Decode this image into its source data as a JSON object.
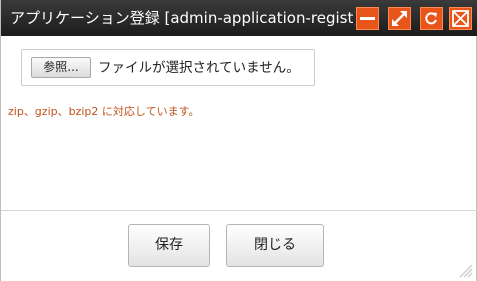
{
  "window": {
    "title": "アプリケーション登録 [admin-application-regist]"
  },
  "titlebar_buttons": {
    "minimize": "minimize-icon",
    "maximize": "expand-icon",
    "reload": "reload-icon",
    "close": "close-icon"
  },
  "form": {
    "browse_label": "参照...",
    "file_status": "ファイルが選択されていません。",
    "note": "zip、gzip、bzip2 に対応しています。"
  },
  "actions": {
    "save_label": "保存",
    "close_label": "閉じる"
  },
  "colors": {
    "titlebar": "#2a2a2a",
    "accent": "#e8551b",
    "note_text": "#c0531b"
  }
}
